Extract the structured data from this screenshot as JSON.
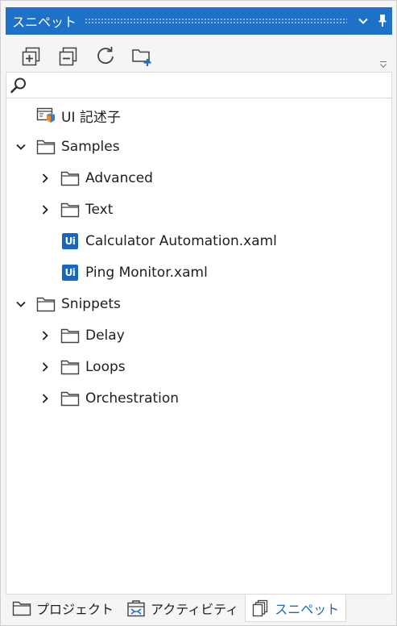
{
  "window": {
    "title": "スニペット",
    "controls": [
      "chevron-down-icon",
      "pin-icon"
    ]
  },
  "toolbar": {
    "buttons": [
      {
        "name": "expand-all-button",
        "icon": "expand-all-icon"
      },
      {
        "name": "collapse-all-button",
        "icon": "collapse-all-icon"
      },
      {
        "name": "refresh-button",
        "icon": "refresh-icon"
      },
      {
        "name": "add-folder-button",
        "icon": "add-folder-icon"
      }
    ]
  },
  "search": {
    "value": "",
    "placeholder": ""
  },
  "tree": {
    "items": [
      {
        "label": "UI 記述子",
        "type": "descriptor",
        "level": 0,
        "expander": "none"
      },
      {
        "label": "Samples",
        "type": "folder",
        "level": 0,
        "expander": "expanded"
      },
      {
        "label": "Advanced",
        "type": "folder",
        "level": 1,
        "expander": "collapsed"
      },
      {
        "label": "Text",
        "type": "folder",
        "level": 1,
        "expander": "collapsed"
      },
      {
        "label": "Calculator Automation.xaml",
        "type": "xaml",
        "level": 1,
        "expander": "none"
      },
      {
        "label": "Ping Monitor.xaml",
        "type": "xaml",
        "level": 1,
        "expander": "none"
      },
      {
        "label": "Snippets",
        "type": "folder",
        "level": 0,
        "expander": "expanded"
      },
      {
        "label": "Delay",
        "type": "folder",
        "level": 1,
        "expander": "collapsed"
      },
      {
        "label": "Loops",
        "type": "folder",
        "level": 1,
        "expander": "collapsed"
      },
      {
        "label": "Orchestration",
        "type": "folder",
        "level": 1,
        "expander": "collapsed"
      }
    ],
    "file_badge": "Ui"
  },
  "bottom_tabs": [
    {
      "label": "プロジェクト",
      "icon": "folder-icon",
      "active": false
    },
    {
      "label": "アクティビティ",
      "icon": "activities-icon",
      "active": false
    },
    {
      "label": "スニペット",
      "icon": "snippets-icon",
      "active": true
    }
  ],
  "colors": {
    "accent": "#1e71c9",
    "badge": "#1766c2",
    "active_tab_text": "#1a66c4"
  }
}
